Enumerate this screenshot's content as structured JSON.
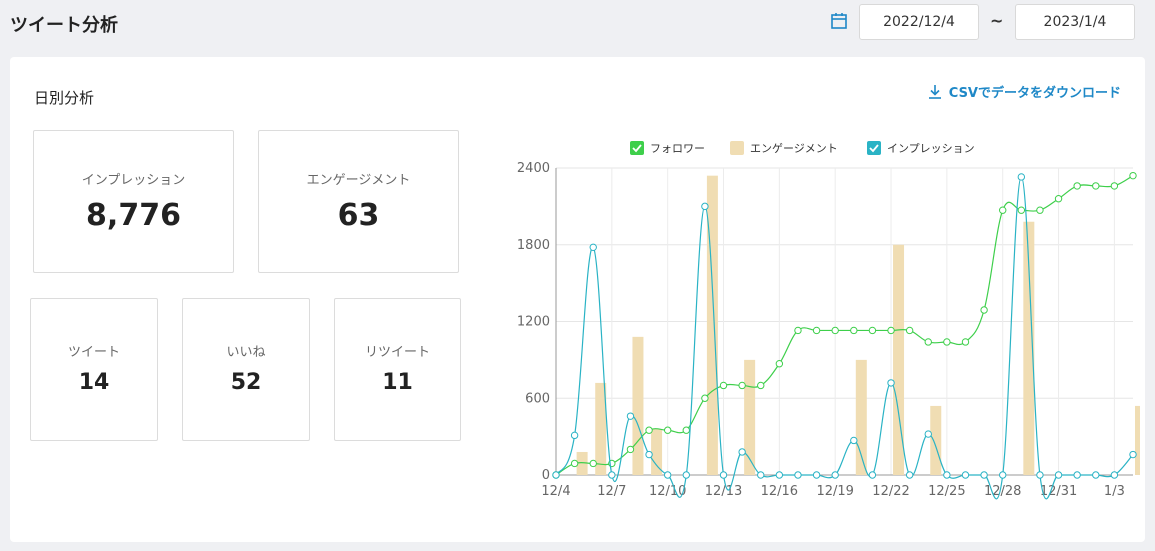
{
  "header": {
    "title": "ツイート分析",
    "date_from": "2022/12/4",
    "date_to": "2023/1/4",
    "separator": "~"
  },
  "section": {
    "title": "日別分析",
    "csv_label": "CSVでデータをダウンロード"
  },
  "stats": {
    "impressions": {
      "label": "インプレッション",
      "value": "8,776"
    },
    "engagement": {
      "label": "エンゲージメント",
      "value": "63"
    },
    "tweets": {
      "label": "ツイート",
      "value": "14"
    },
    "likes": {
      "label": "いいね",
      "value": "52"
    },
    "retweets": {
      "label": "リツイート",
      "value": "11"
    }
  },
  "colors": {
    "accent": "#1e88c7",
    "followers": "#3ecf4b",
    "engagement": "#f0ddb3",
    "impressions": "#2ab3c5"
  },
  "chart_data": {
    "type": "bar",
    "x": [
      "12/4",
      "12/5",
      "12/6",
      "12/7",
      "12/8",
      "12/9",
      "12/10",
      "12/11",
      "12/12",
      "12/13",
      "12/14",
      "12/15",
      "12/16",
      "12/17",
      "12/18",
      "12/19",
      "12/20",
      "12/21",
      "12/22",
      "12/23",
      "12/24",
      "12/25",
      "12/26",
      "12/27",
      "12/28",
      "12/29",
      "12/30",
      "12/31",
      "1/1",
      "1/2",
      "1/3",
      "1/4"
    ],
    "tick_labels": [
      "12/4",
      "12/7",
      "12/10",
      "12/13",
      "12/16",
      "12/19",
      "12/22",
      "12/25",
      "12/28",
      "12/31",
      "1/3"
    ],
    "ylim": [
      0,
      2400
    ],
    "yticks": [
      0,
      600,
      1200,
      1800,
      2400
    ],
    "legend": [
      "フォロワー",
      "エンゲージメント",
      "インプレッション"
    ],
    "legend_position": "top",
    "grid": true,
    "series": [
      {
        "name": "フォロワー",
        "kind": "line",
        "values": [
          0,
          90,
          90,
          90,
          200,
          350,
          350,
          350,
          600,
          700,
          700,
          700,
          870,
          1130,
          1130,
          1130,
          1130,
          1130,
          1130,
          1130,
          1040,
          1040,
          1040,
          1290,
          2070,
          2070,
          2070,
          2160,
          2260,
          2260,
          2260,
          2340
        ]
      },
      {
        "name": "エンゲージメント",
        "kind": "bar",
        "values": [
          0,
          180,
          720,
          0,
          1080,
          360,
          0,
          0,
          2340,
          0,
          900,
          0,
          0,
          0,
          0,
          0,
          900,
          0,
          1800,
          0,
          540,
          0,
          0,
          0,
          0,
          1980,
          0,
          0,
          0,
          0,
          0,
          540
        ]
      },
      {
        "name": "インプレッション",
        "kind": "line",
        "values": [
          0,
          310,
          1780,
          0,
          460,
          160,
          0,
          0,
          2100,
          0,
          180,
          0,
          0,
          0,
          0,
          0,
          270,
          0,
          720,
          0,
          320,
          0,
          0,
          0,
          0,
          2330,
          0,
          0,
          0,
          0,
          0,
          160
        ]
      }
    ]
  }
}
